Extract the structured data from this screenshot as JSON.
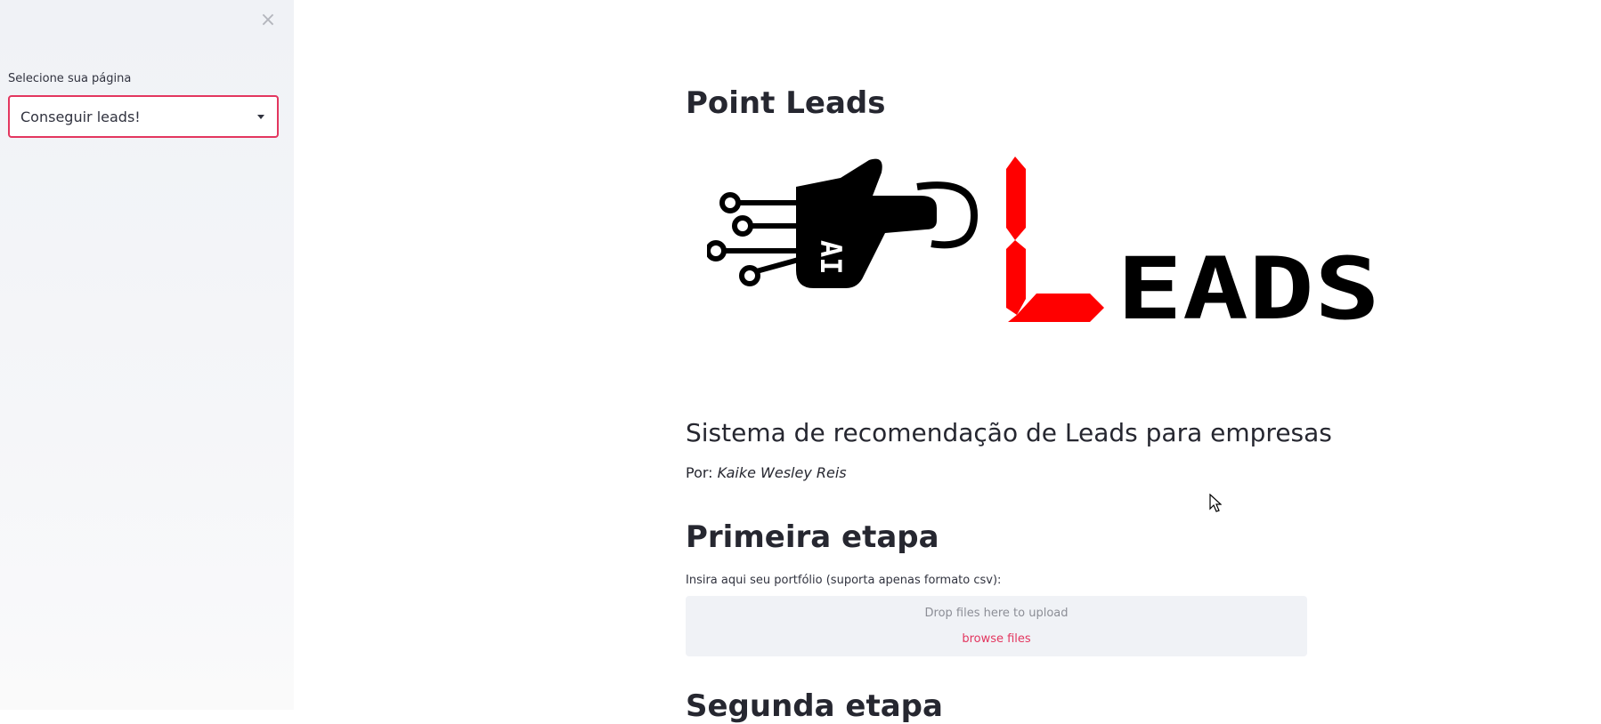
{
  "sidebar": {
    "close_icon": "close-icon",
    "select_label": "Selecione sua página",
    "selected_value": "Conseguir leads!"
  },
  "main": {
    "title": "Point Leads",
    "logo": {
      "hand_text": "AI",
      "word_text": "EADS",
      "letter": "L",
      "accent_color": "#ff0000",
      "ink_color": "#000000"
    },
    "subtitle": "Sistema de recomendação de Leads para empresas",
    "author_prefix": "Por:",
    "author_name": "Kaike Wesley Reis",
    "section1_title": "Primeira etapa",
    "upload_label": "Insira aqui seu portfólio (suporta apenas formato csv):",
    "drop_text": "Drop files here to upload",
    "browse_text": "browse files",
    "section2_title": "Segunda etapa"
  },
  "colors": {
    "accent": "#e3365f",
    "sidebar_bg": "#f0f2f6",
    "text": "#262730"
  }
}
